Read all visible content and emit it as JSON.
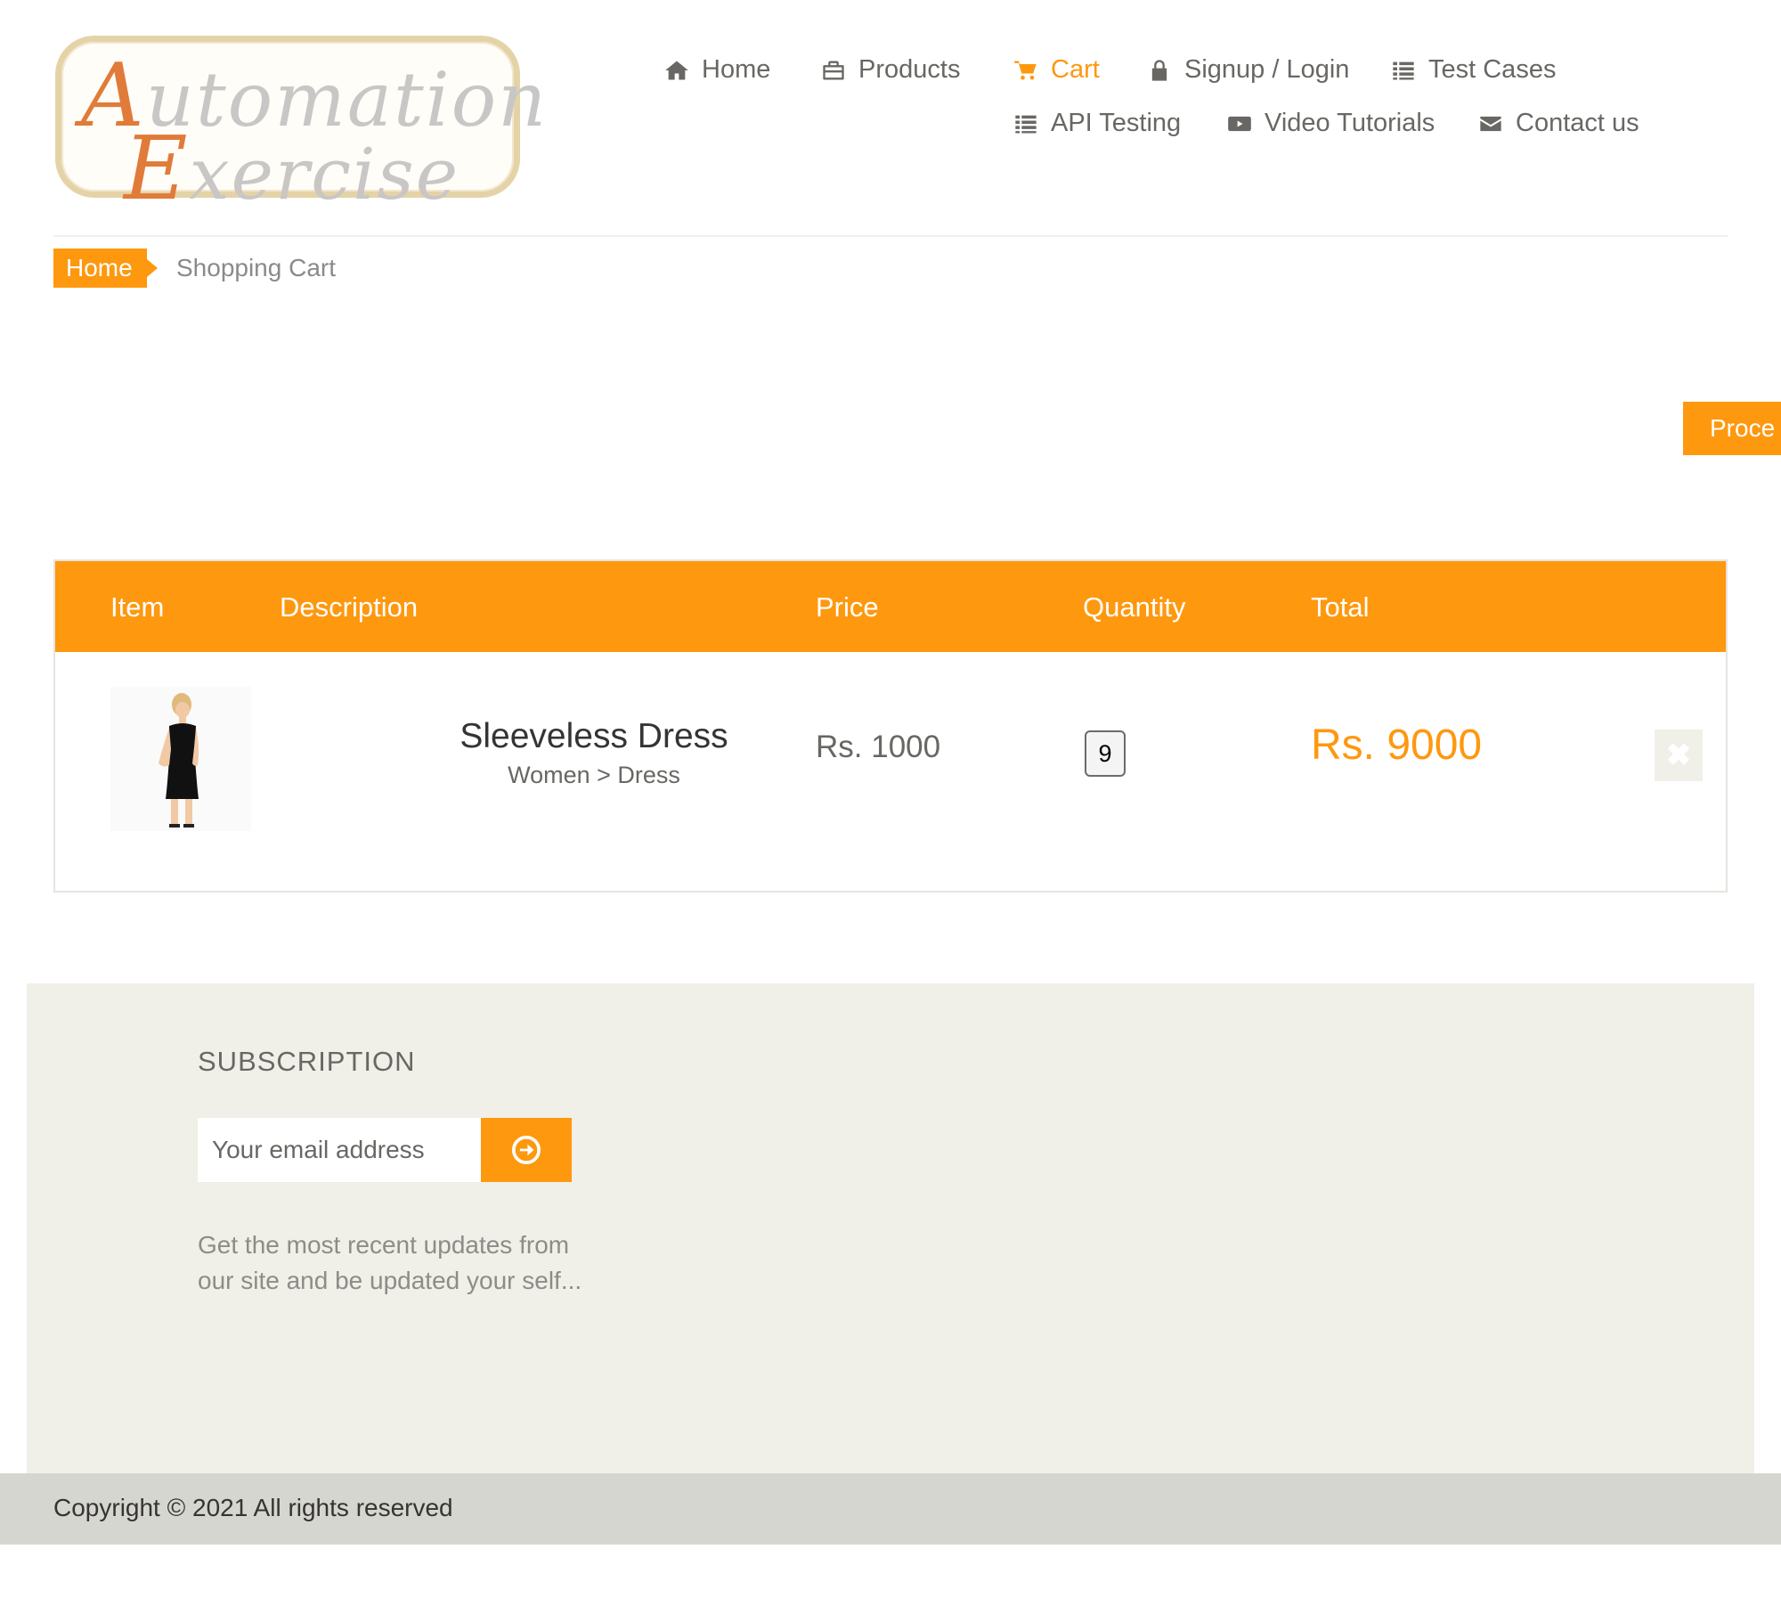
{
  "header": {
    "logo_text_line1": "Automation",
    "logo_text_line2": "Exercise",
    "nav": [
      {
        "label": "Home",
        "icon": "home-icon"
      },
      {
        "label": "Products",
        "icon": "briefcase-icon"
      },
      {
        "label": "Cart",
        "icon": "cart-icon",
        "active": true
      },
      {
        "label": "Signup / Login",
        "icon": "lock-icon"
      },
      {
        "label": "Test Cases",
        "icon": "list-icon"
      },
      {
        "label": "API Testing",
        "icon": "list-icon"
      },
      {
        "label": "Video Tutorials",
        "icon": "youtube-icon"
      },
      {
        "label": "Contact us",
        "icon": "envelope-icon"
      }
    ]
  },
  "breadcrumb": {
    "home": "Home",
    "current": "Shopping Cart"
  },
  "checkout": {
    "proceed_label": "Proce"
  },
  "cart": {
    "columns": [
      "Item",
      "Description",
      "Price",
      "Quantity",
      "Total"
    ],
    "items": [
      {
        "name": "Sleeveless Dress",
        "category": "Women > Dress",
        "price": "Rs. 1000",
        "quantity": "9",
        "total": "Rs. 9000",
        "delete_icon": "close-icon"
      }
    ]
  },
  "footer": {
    "subscription_title": "SUBSCRIPTION",
    "email_placeholder": "Your email address",
    "subscribe_icon": "arrow-circle-right-icon",
    "subscription_text": "Get the most recent updates from our site and be updated your self...",
    "copyright": "Copyright © 2021 All rights reserved"
  },
  "colors": {
    "accent": "#fe980f",
    "text": "#696763",
    "footer_bg": "#f0f0e9",
    "footer_bottom_bg": "#d6d6d0"
  }
}
